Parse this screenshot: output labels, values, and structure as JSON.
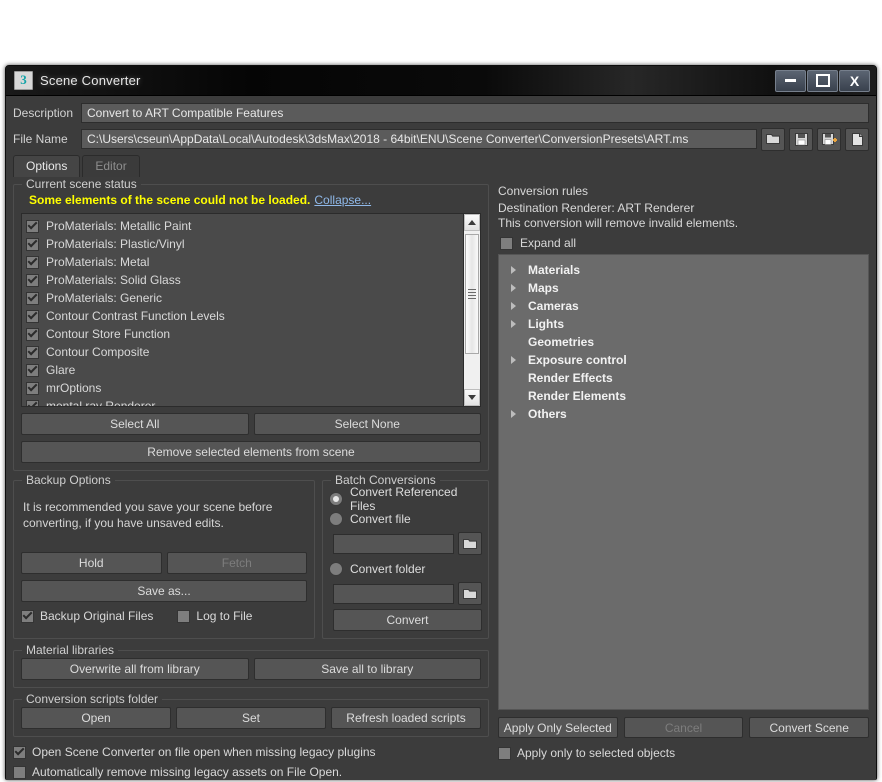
{
  "window": {
    "title": "Scene Converter",
    "app_icon": "3dsmax-icon",
    "minimize_label": "Minimize",
    "maximize_label": "Maximize",
    "close_label": "Close"
  },
  "header": {
    "description_label": "Description",
    "description_value": "Convert to ART Compatible Features",
    "file_name_label": "File Name",
    "file_name_value": "C:\\Users\\cseun\\AppData\\Local\\Autodesk\\3dsMax\\2018 - 64bit\\ENU\\Scene Converter\\ConversionPresets\\ART.ms",
    "icon_buttons": [
      {
        "name": "open-preset-icon",
        "title": "Open"
      },
      {
        "name": "save-preset-icon",
        "title": "Save"
      },
      {
        "name": "save-as-preset-icon",
        "title": "Save As"
      },
      {
        "name": "new-preset-icon",
        "title": "New"
      }
    ]
  },
  "tabs": [
    {
      "label": "Options",
      "active": true
    },
    {
      "label": "Editor",
      "active": false
    }
  ],
  "scene_status": {
    "group_title": "Current scene status",
    "warning": "Some elements of the scene could not be loaded.",
    "collapse_link": "Collapse...",
    "items": [
      {
        "label": "ProMaterials: Metallic Paint",
        "checked": true
      },
      {
        "label": "ProMaterials: Plastic/Vinyl",
        "checked": true
      },
      {
        "label": "ProMaterials: Metal",
        "checked": true
      },
      {
        "label": "ProMaterials: Solid Glass",
        "checked": true
      },
      {
        "label": "ProMaterials: Generic",
        "checked": true
      },
      {
        "label": "Contour Contrast Function Levels",
        "checked": true
      },
      {
        "label": "Contour Store Function",
        "checked": true
      },
      {
        "label": "Contour Composite",
        "checked": true
      },
      {
        "label": "Glare",
        "checked": true
      },
      {
        "label": "mrOptions",
        "checked": true
      },
      {
        "label": "mental ray Renderer",
        "checked": true
      }
    ],
    "select_all_label": "Select All",
    "select_none_label": "Select None",
    "remove_label": "Remove selected elements from scene"
  },
  "backup": {
    "group_title": "Backup Options",
    "hint": "It is recommended you save your scene before converting, if you have unsaved edits.",
    "hold_label": "Hold",
    "fetch_label": "Fetch",
    "save_as_label": "Save as...",
    "backup_original_label": "Backup Original Files",
    "backup_original_checked": true,
    "log_to_file_label": "Log to File",
    "log_to_file_checked": false
  },
  "batch": {
    "group_title": "Batch Conversions",
    "convert_referenced_label": "Convert Referenced Files",
    "convert_file_label": "Convert file",
    "convert_folder_label": "Convert folder",
    "selected": "Convert Referenced Files",
    "file_path_value": "",
    "folder_path_value": "",
    "browse_icon": "folder-icon",
    "convert_label": "Convert"
  },
  "material_libraries": {
    "group_title": "Material libraries",
    "overwrite_label": "Overwrite all from library",
    "save_all_label": "Save all to library"
  },
  "scripts_folder": {
    "group_title": "Conversion scripts folder",
    "open_label": "Open",
    "set_label": "Set",
    "refresh_label": "Refresh loaded scripts"
  },
  "footer_options": [
    {
      "label": "Open Scene Converter on file open when missing legacy plugins",
      "checked": true
    },
    {
      "label": "Automatically remove missing legacy assets on File Open.",
      "checked": false
    }
  ],
  "conversion_rules": {
    "group_title": "Conversion rules",
    "destination_line": "Destination Renderer: ART Renderer",
    "note_line": "This conversion will remove invalid elements.",
    "expand_all_label": "Expand all",
    "expand_all_checked": false,
    "tree": [
      {
        "label": "Materials",
        "has_arrow": true
      },
      {
        "label": "Maps",
        "has_arrow": true
      },
      {
        "label": "Cameras",
        "has_arrow": true
      },
      {
        "label": "Lights",
        "has_arrow": true
      },
      {
        "label": "Geometries",
        "has_arrow": false
      },
      {
        "label": "Exposure control",
        "has_arrow": true
      },
      {
        "label": "Render Effects",
        "has_arrow": false
      },
      {
        "label": "Render Elements",
        "has_arrow": false
      },
      {
        "label": "Others",
        "has_arrow": true
      }
    ],
    "apply_only_selected_label": "Apply Only Selected",
    "cancel_label": "Cancel",
    "cancel_disabled": true,
    "convert_scene_label": "Convert Scene",
    "apply_only_objects_label": "Apply only to selected objects",
    "apply_only_objects_checked": false
  },
  "colors": {
    "window_bg": "#3c3c3c",
    "warning_yellow": "#ffff00",
    "link_blue": "#8fb8e8",
    "tree_bg": "#6b6b6b",
    "accent_icon": "#12a3a8"
  }
}
